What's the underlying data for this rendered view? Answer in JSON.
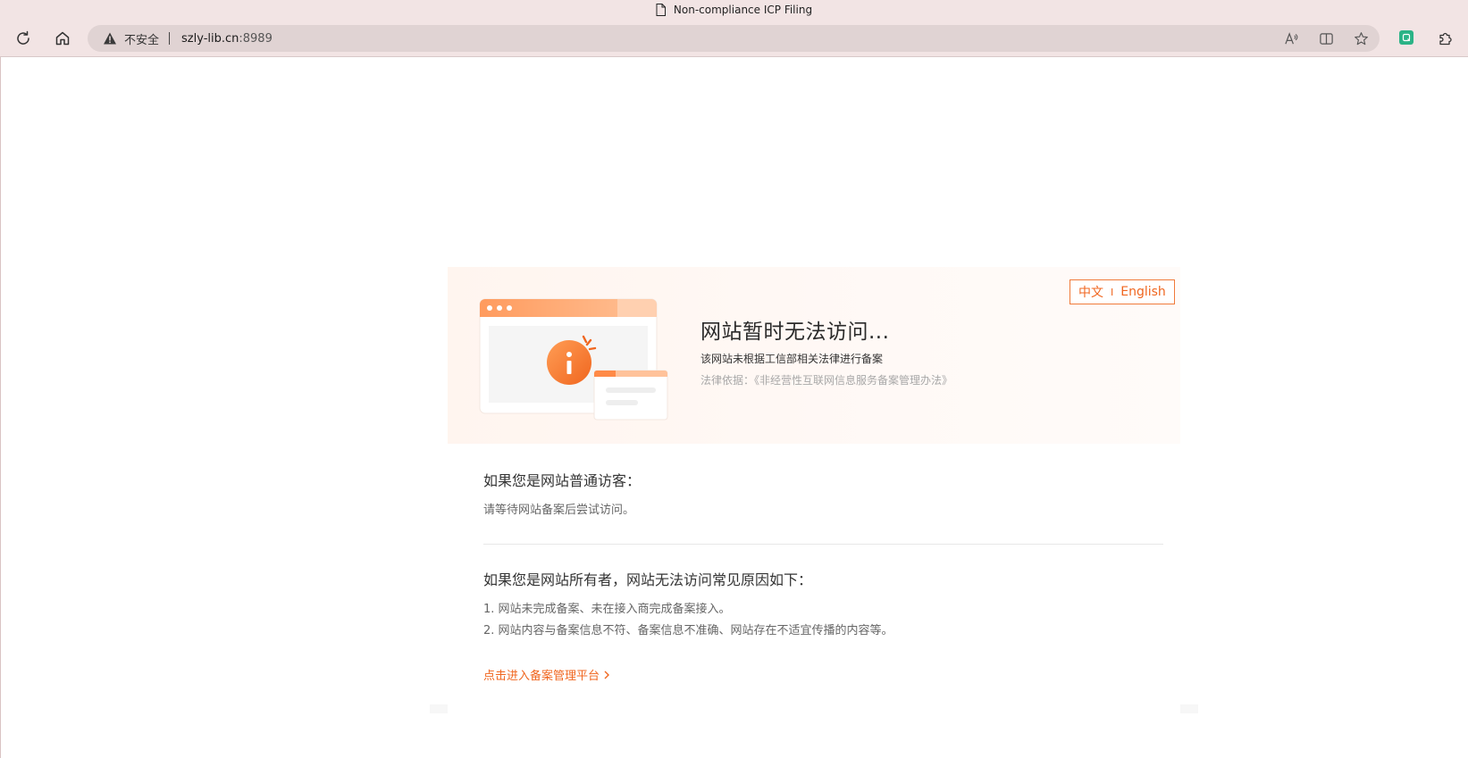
{
  "browser": {
    "tab_title": "Non-compliance ICP Filing",
    "security_label": "不安全",
    "url_host": "szly-lib.cn",
    "url_port": ":8989",
    "icons": {
      "refresh": "refresh-icon",
      "home": "home-icon",
      "warning": "warning-icon",
      "read_aloud": "read-aloud-icon",
      "split_screen": "split-screen-icon",
      "favorite": "star-icon",
      "extension": "extension-icon",
      "extensions_menu": "puzzle-icon"
    }
  },
  "page": {
    "lang_zh": "中文",
    "lang_divider": "I",
    "lang_en": "English",
    "title": "网站暂时无法访问...",
    "notice": "该网站未根据工信部相关法律进行备案",
    "law_basis": "法律依据：《非经营性互联网信息服务备案管理办法》",
    "visitor_heading": "如果您是网站普通访客：",
    "visitor_text": "请等待网站备案后尝试访问。",
    "owner_heading": "如果您是网站所有者，网站无法访问常见原因如下：",
    "reasons": [
      "1. 网站未完成备案、未在接入商完成备案接入。",
      "2. 网站内容与备案信息不符、备案信息不准确、网站存在不适宜传播的内容等。"
    ],
    "platform_link": "点击进入备案管理平台"
  },
  "colors": {
    "accent": "#f0661f",
    "chrome_bg": "#f2e4e4",
    "address_bg": "#e0d3d3",
    "panel_bg": "#fff5ef"
  }
}
